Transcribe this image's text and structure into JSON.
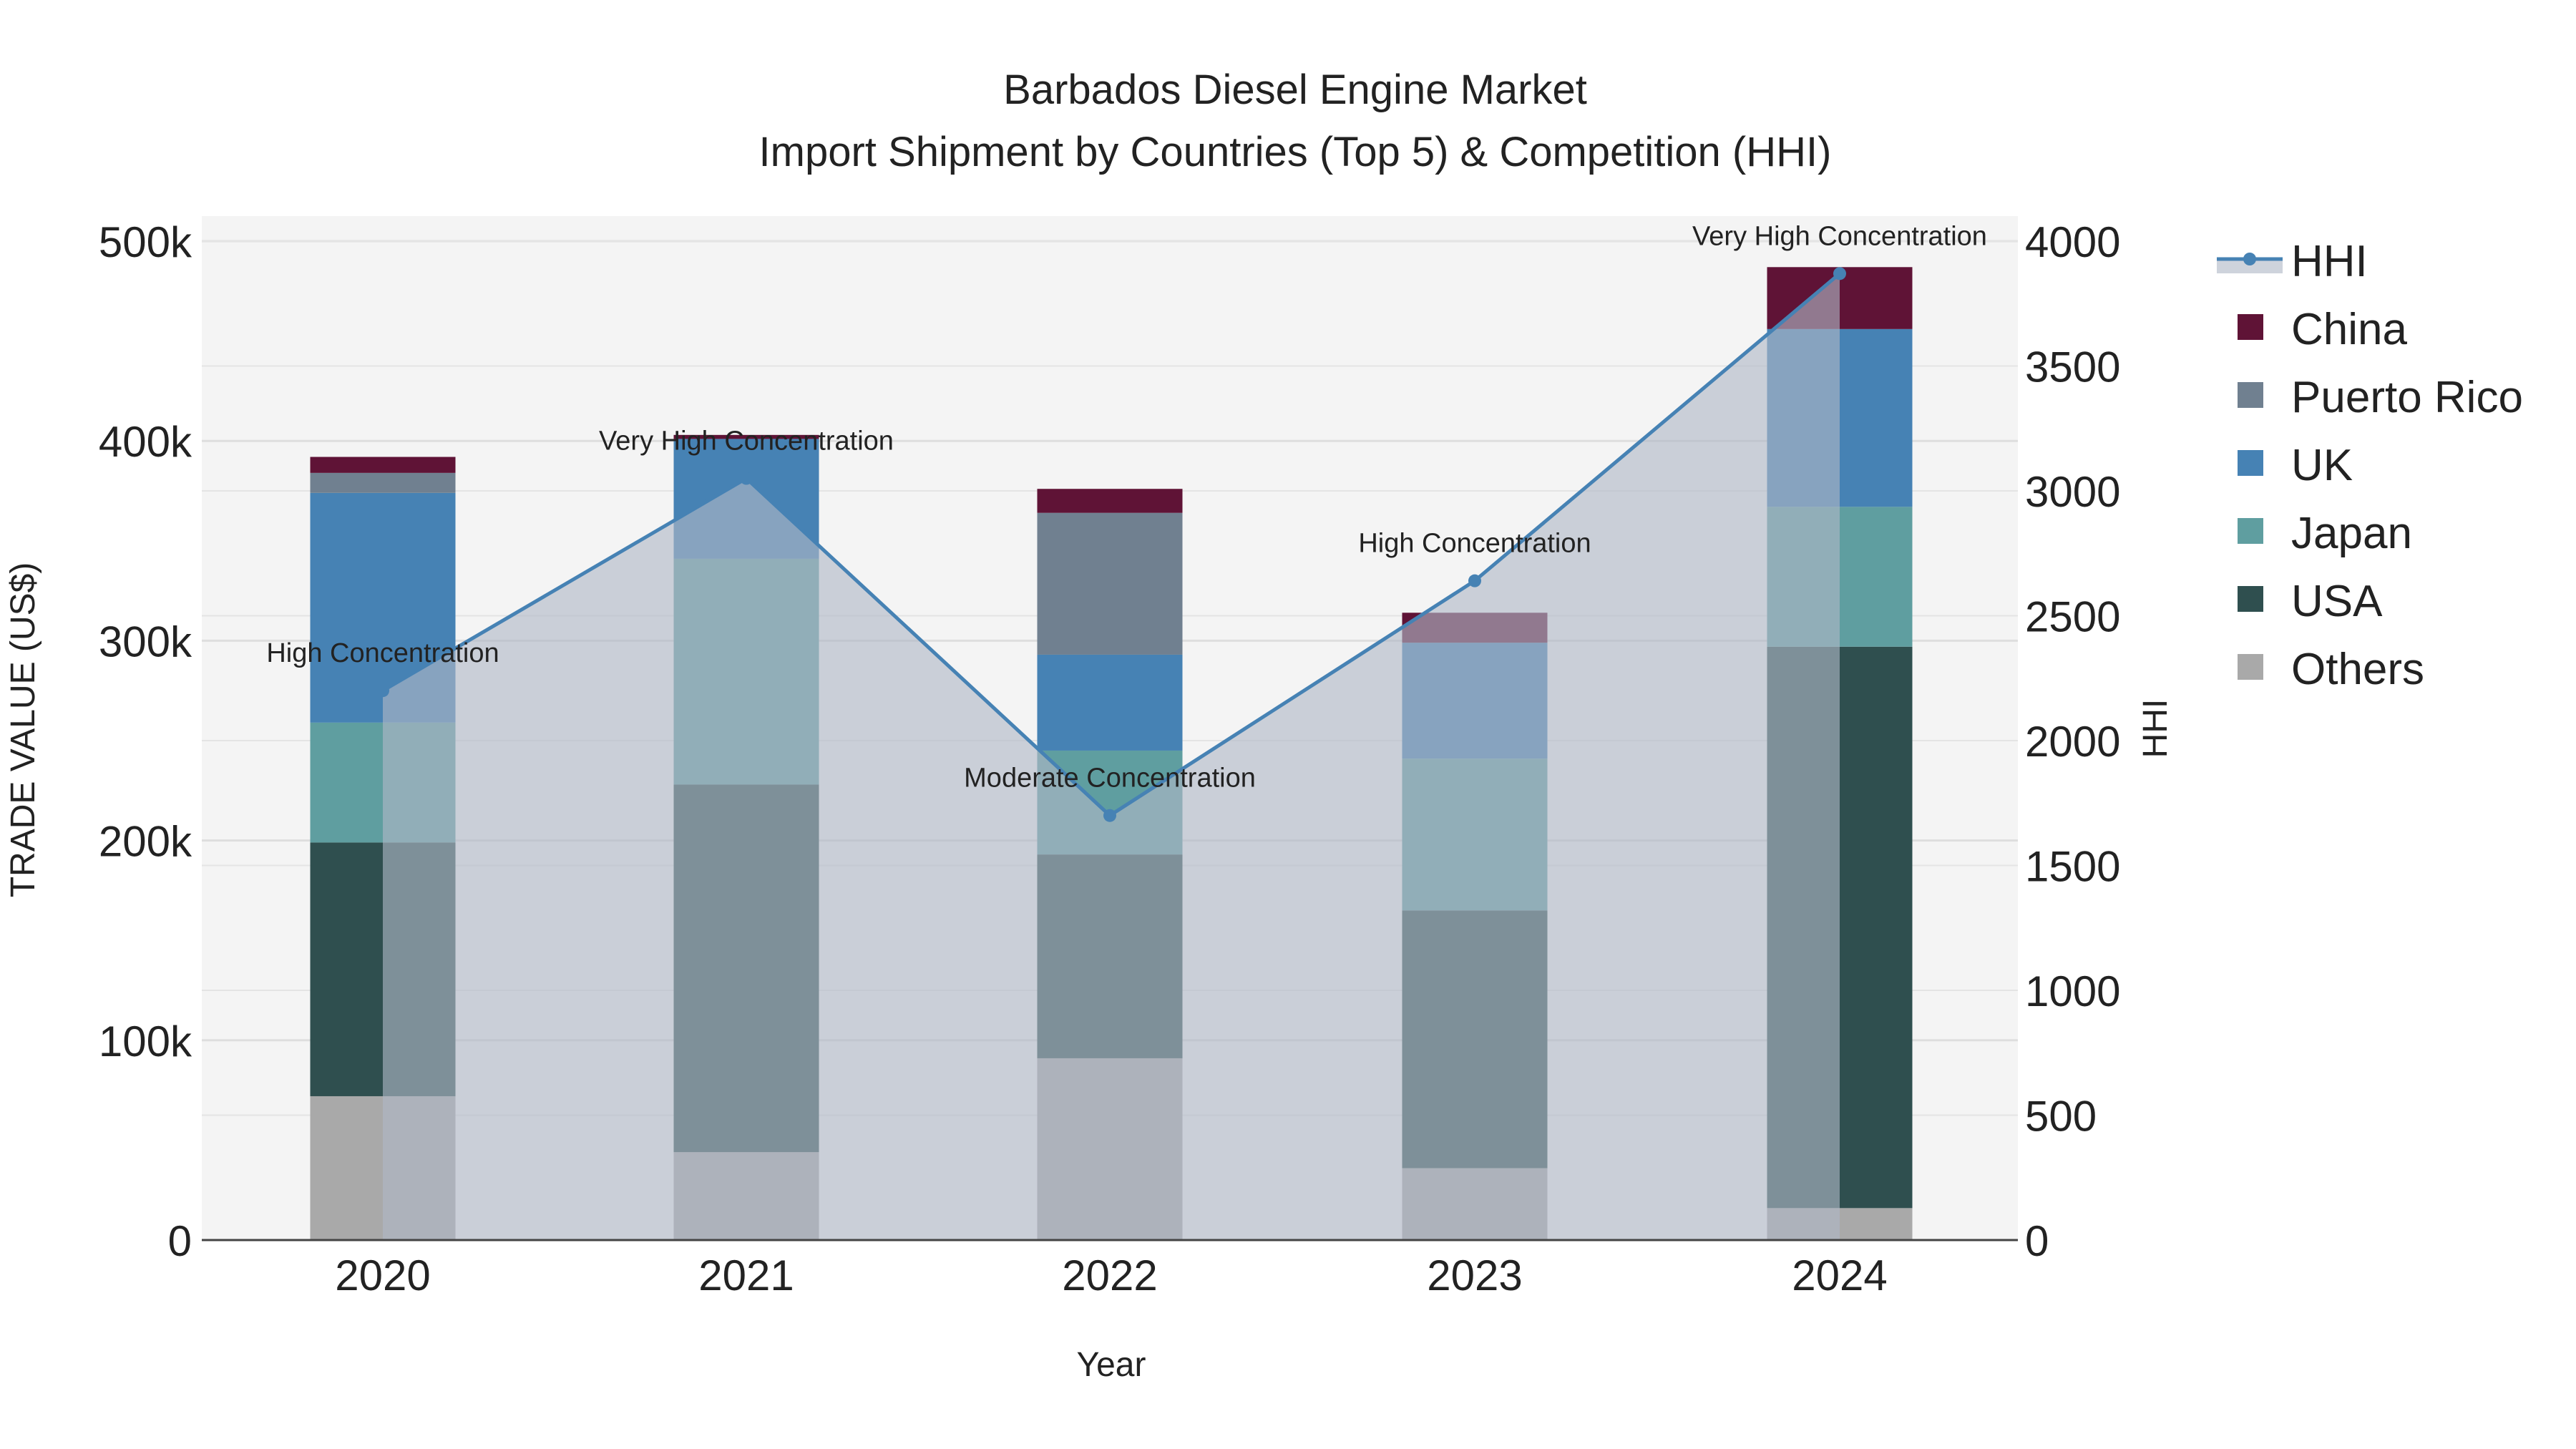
{
  "chart_data": {
    "type": "bar",
    "title": "Barbados Diesel Engine Market",
    "subtitle": "Import Shipment by Countries (Top 5) & Competition (HHI)",
    "xlabel": "Year",
    "ylabel": "TRADE VALUE (US$)",
    "y2label": "HHI",
    "categories": [
      "2020",
      "2021",
      "2022",
      "2023",
      "2024"
    ],
    "ylim": [
      0,
      510000
    ],
    "y2lim": [
      0,
      4080
    ],
    "yticks": [
      0,
      100000,
      200000,
      300000,
      400000,
      500000
    ],
    "ytick_labels": [
      "0",
      "100k",
      "200k",
      "300k",
      "400k",
      "500k"
    ],
    "y2ticks": [
      0,
      500,
      1000,
      1500,
      2000,
      2500,
      3000,
      3500,
      4000
    ],
    "y2tick_labels": [
      "0",
      "500",
      "1000",
      "1500",
      "2000",
      "2500",
      "3000",
      "3500",
      "4000"
    ],
    "series": [
      {
        "name": "Others",
        "color": "#a9a9a9",
        "values": [
          72000,
          44000,
          91000,
          36000,
          16000
        ]
      },
      {
        "name": "USA",
        "color": "#2f4f4f",
        "values": [
          127000,
          184000,
          102000,
          129000,
          281000
        ]
      },
      {
        "name": "Japan",
        "color": "#5f9ea0",
        "values": [
          60000,
          113000,
          52000,
          76000,
          70000
        ]
      },
      {
        "name": "UK",
        "color": "#4682b4",
        "values": [
          115000,
          60000,
          48000,
          58000,
          89000
        ]
      },
      {
        "name": "Puerto Rico",
        "color": "#708090",
        "values": [
          10000,
          0,
          71000,
          0,
          0
        ]
      },
      {
        "name": "China",
        "color": "#5f1336",
        "values": [
          8000,
          2000,
          12000,
          15000,
          31000
        ]
      }
    ],
    "hhi": {
      "name": "HHI",
      "color": "#4682b4",
      "values": [
        2200,
        3050,
        1700,
        2640,
        3870
      ],
      "annotations": [
        "High Concentration",
        "Very High Concentration",
        "Moderate Concentration",
        "High Concentration",
        "Very High Concentration"
      ]
    },
    "legend": {
      "position": "right",
      "order": [
        "HHI",
        "China",
        "Puerto Rico",
        "UK",
        "Japan",
        "USA",
        "Others"
      ]
    },
    "grid": true
  }
}
